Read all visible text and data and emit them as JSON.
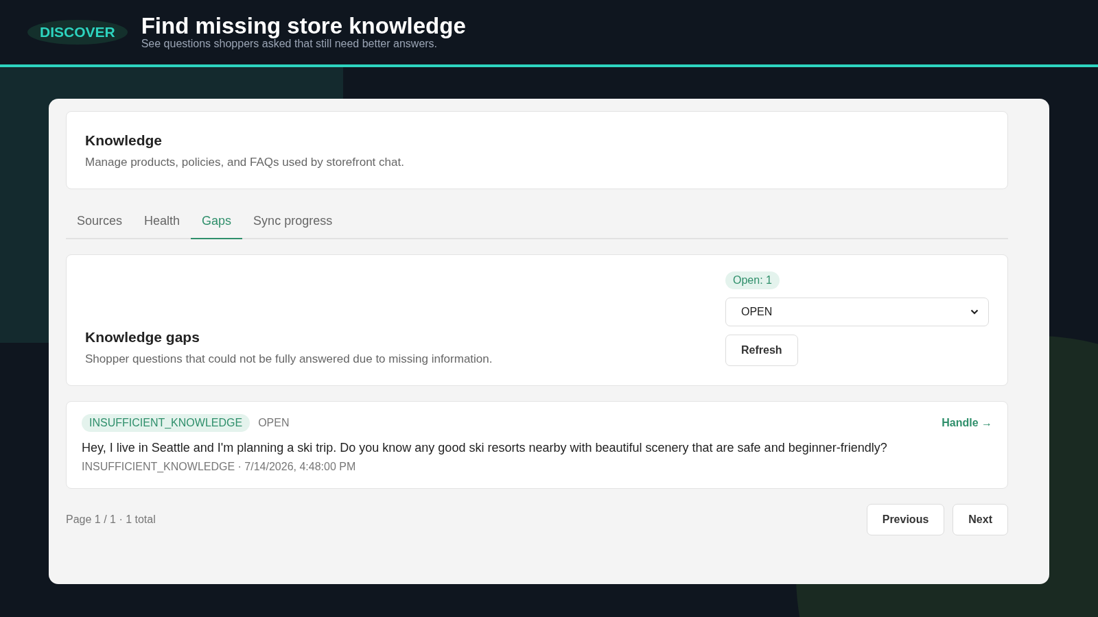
{
  "header": {
    "badge": "DISCOVER",
    "title": "Find missing store knowledge",
    "subtitle": "See questions shoppers asked that still need better answers."
  },
  "intro": {
    "title": "Knowledge",
    "description": "Manage products, policies, and FAQs used by storefront chat."
  },
  "tabs": [
    {
      "label": "Sources",
      "selected": false
    },
    {
      "label": "Health",
      "selected": false
    },
    {
      "label": "Gaps",
      "selected": true
    },
    {
      "label": "Sync progress",
      "selected": false
    }
  ],
  "gaps_panel": {
    "title": "Knowledge gaps",
    "description": "Shopper questions that could not be fully answered due to missing information.",
    "count_badge": "Open: 1",
    "status_filter": "OPEN",
    "refresh_button": "Refresh"
  },
  "gaps": [
    {
      "tag": "INSUFFICIENT_KNOWLEDGE",
      "status": "OPEN",
      "question": "Hey, I live in Seattle and I'm planning a ski trip. Do you know any good ski resorts nearby with beautiful scenery that are safe and beginner-friendly?",
      "meta": "INSUFFICIENT_KNOWLEDGE · 7/14/2026, 4:48:00 PM",
      "action": "Handle →"
    }
  ],
  "pagination": {
    "summary": "Page 1 / 1 · 1 total",
    "previous": "Previous",
    "next": "Next"
  }
}
